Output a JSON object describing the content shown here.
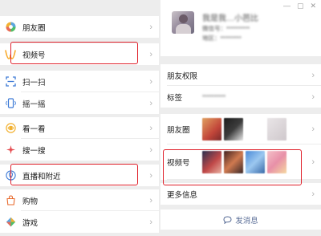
{
  "discover": {
    "items": [
      {
        "label": "朋友圈",
        "icon": "moments-icon"
      },
      {
        "label": "视频号",
        "icon": "channels-icon"
      },
      {
        "label": "扫一扫",
        "icon": "scan-icon"
      },
      {
        "label": "摇一摇",
        "icon": "shake-icon"
      },
      {
        "label": "看一看",
        "icon": "top-stories-icon"
      },
      {
        "label": "搜一搜",
        "icon": "search-icon"
      },
      {
        "label": "直播和附近",
        "icon": "live-nearby-icon"
      },
      {
        "label": "购物",
        "icon": "shopping-icon"
      },
      {
        "label": "游戏",
        "icon": "games-icon"
      }
    ]
  },
  "profile": {
    "name": "我是我…小芭比",
    "wechat_id": "微信号：**********",
    "region": "地区：*********",
    "tag_value": "**********",
    "rows": {
      "permissions": "朋友权限",
      "tags": "标签",
      "moments": "朋友圈",
      "channels": "视频号",
      "more_info": "更多信息"
    },
    "send_message": "发消息"
  },
  "colors": {
    "highlight_border": "#e0202a",
    "link_blue": "#576b95",
    "chevron": "#b3b3b3"
  }
}
